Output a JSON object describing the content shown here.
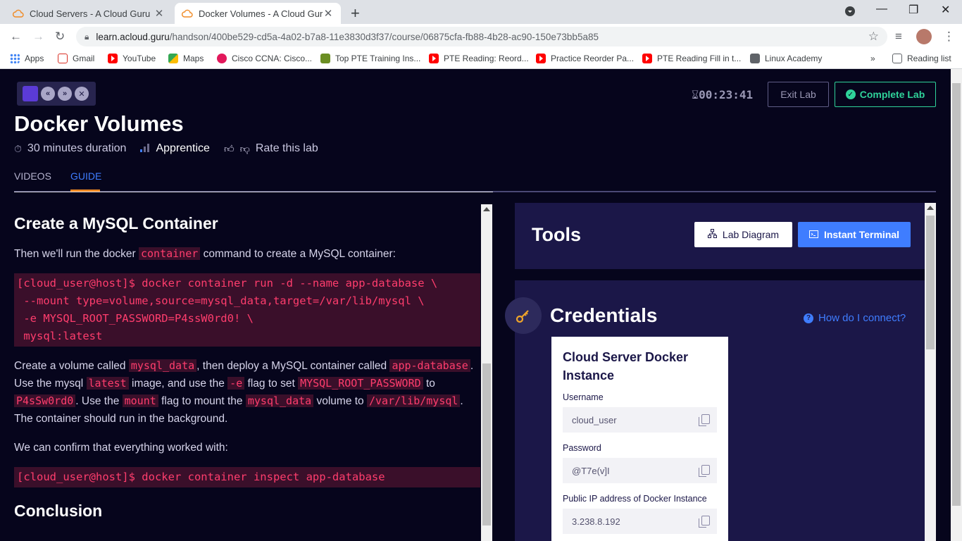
{
  "browser": {
    "tabs": [
      {
        "title": "Cloud Servers - A Cloud Guru",
        "icon": "cloud-icon"
      },
      {
        "title": "Docker Volumes - A Cloud Guru",
        "icon": "cloud-icon"
      }
    ],
    "url_host": "learn.acloud.guru",
    "url_path": "/handson/400be529-cd5a-4a02-b7a8-11e3830d3f37/course/06875cfa-fb88-4b28-ac90-150e73bb5a85",
    "bookmarks": [
      "Apps",
      "Gmail",
      "YouTube",
      "Maps",
      "Cisco CCNA: Cisco...",
      "Top PTE Training Ins...",
      "PTE Reading: Reord...",
      "Practice Reorder Pa...",
      "PTE Reading Fill in t...",
      "Linux Academy"
    ],
    "reading_list": "Reading list",
    "overflow": "»"
  },
  "lab": {
    "timer": "00:23:41",
    "exit_label": "Exit Lab",
    "complete_label": "Complete Lab",
    "title": "Docker Volumes",
    "duration": "30 minutes duration",
    "level": "Apprentice",
    "rate": "Rate this lab",
    "tab_videos": "VIDEOS",
    "tab_guide": "GUIDE"
  },
  "guide": {
    "heading": "Create a MySQL Container",
    "intro_before": "Then we'll run the docker ",
    "intro_code": "container",
    "intro_after": " command to create a MySQL container:",
    "code_block_1": "[cloud_user@host]$ docker container run -d --name app-database \\\n --mount type=volume,source=mysql_data,target=/var/lib/mysql \\\n -e MYSQL_ROOT_PASSWORD=P4ssW0rd0! \\\n mysql:latest",
    "p2_a": "Create a volume called ",
    "p2_c1": "mysql_data",
    "p2_b": ", then deploy a MySQL container called ",
    "p2_c2": "app-database",
    "p2_c": ". Use the mysql ",
    "p2_c3": "latest",
    "p2_d": " image, and use the ",
    "p2_c4": "-e",
    "p2_e": " flag to set ",
    "p2_c5": "MYSQL_ROOT_PASSWORD",
    "p2_f": " to ",
    "p2_c6": "P4sSw0rd0",
    "p2_g": ". Use the ",
    "p2_c7": "mount",
    "p2_h": " flag to mount the ",
    "p2_c8": "mysql_data",
    "p2_i": " volume to ",
    "p2_c9": "/var/lib/mysql",
    "p2_j": ". The container should run in the background.",
    "confirm": "We can confirm that everything worked with:",
    "code_block_2": "[cloud_user@host]$ docker container inspect app-database",
    "heading2": "Conclusion"
  },
  "tools": {
    "title": "Tools",
    "diagram_label": "Lab Diagram",
    "terminal_label": "Instant Terminal"
  },
  "credentials": {
    "title": "Credentials",
    "help": "How do I connect?",
    "server_title": "Cloud Server Docker Instance",
    "username_label": "Username",
    "username": "cloud_user",
    "password_label": "Password",
    "password": "@T7e(v]I",
    "ip_label": "Public IP address of Docker Instance",
    "ip": "3.238.8.192"
  },
  "colors": {
    "accent_blue": "#3f7dff",
    "accent_green": "#2fd39a",
    "code_pink": "#ff3d6d",
    "tab_orange": "#f08a24"
  }
}
